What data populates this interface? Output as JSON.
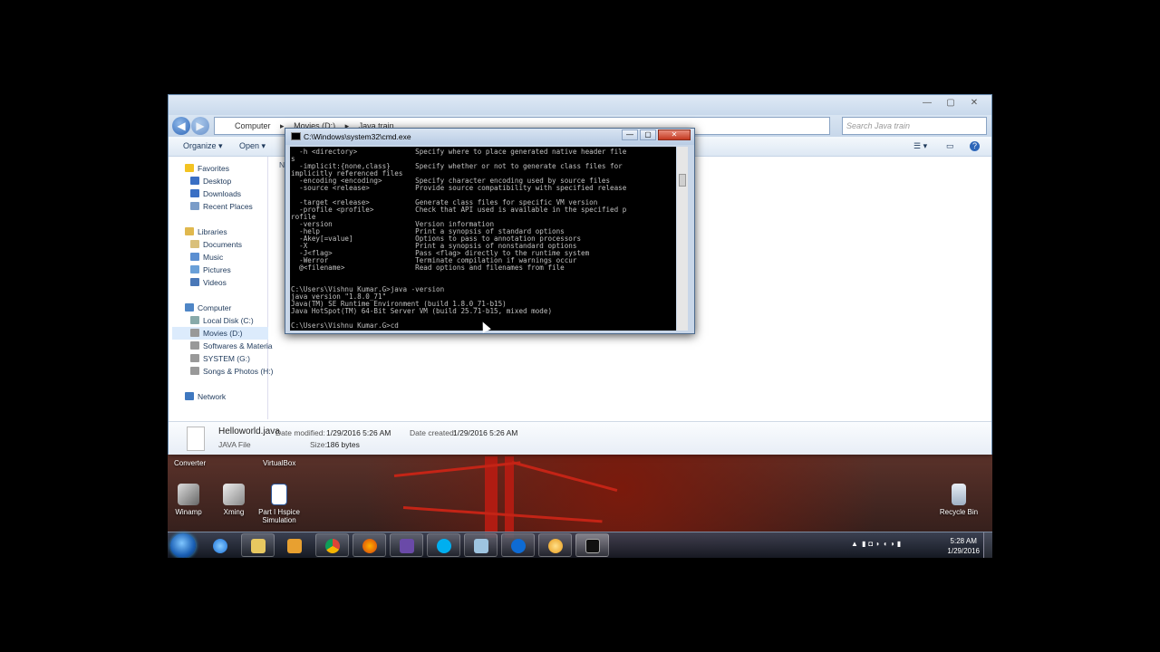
{
  "explorer": {
    "address_parts": [
      "Computer",
      "Movies (D:)",
      "Java train"
    ],
    "search_placeholder": "Search Java train",
    "toolbar": {
      "organize": "Organize",
      "open": "Open"
    },
    "column_stub": "Na",
    "nav": {
      "favorites": "Favorites",
      "desktop": "Desktop",
      "downloads": "Downloads",
      "recent": "Recent Places",
      "libraries": "Libraries",
      "documents": "Documents",
      "music": "Music",
      "pictures": "Pictures",
      "videos": "Videos",
      "computer": "Computer",
      "local_disk": "Local Disk (C:)",
      "movies": "Movies (D:)",
      "softwares": "Softwares & Materia",
      "system": "SYSTEM (G:)",
      "songs": "Songs & Photos (H:)",
      "network": "Network"
    },
    "details": {
      "file_name": "Helloworld.java",
      "file_type": "JAVA File",
      "date_modified_label": "Date modified:",
      "date_modified": "1/29/2016 5:26 AM",
      "date_created_label": "Date created:",
      "date_created": "1/29/2016 5:26 AM",
      "size_label": "Size:",
      "size": "186 bytes"
    }
  },
  "cmd": {
    "title": "C:\\Windows\\system32\\cmd.exe",
    "output": "  -h <directory>              Specify where to place generated native header file\ns\n  -implicit:{none,class}      Specify whether or not to generate class files for\nimplicitly referenced files\n  -encoding <encoding>        Specify character encoding used by source files\n  -source <release>           Provide source compatibility with specified release\n\n  -target <release>           Generate class files for specific VM version\n  -profile <profile>          Check that API used is available in the specified p\nrofile\n  -version                    Version information\n  -help                       Print a synopsis of standard options\n  -Akey[=value]               Options to pass to annotation processors\n  -X                          Print a synopsis of nonstandard options\n  -J<flag>                    Pass <flag> directly to the runtime system\n  -Werror                     Terminate compilation if warnings occur\n  @<filename>                 Read options and filenames from file\n\n\nC:\\Users\\Vishnu Kumar.G>java -version\njava version \"1.8.0_71\"\nJava(TM) SE Runtime Environment (build 1.8.0_71-b15)\nJava HotSpot(TM) 64-Bit Server VM (build 25.71-b15, mixed mode)\n\nC:\\Users\\Vishnu Kumar.G>cd"
  },
  "desktop": {
    "labels": {
      "converter": "Converter",
      "virtualbox": "VirtualBox"
    },
    "icons": {
      "winamp": "Winamp",
      "xming": "Xming",
      "hspice": "Part I Hspice Simulation",
      "recycle": "Recycle Bin"
    }
  },
  "taskbar": {
    "time": "5:28 AM",
    "date": "1/29/2016"
  }
}
